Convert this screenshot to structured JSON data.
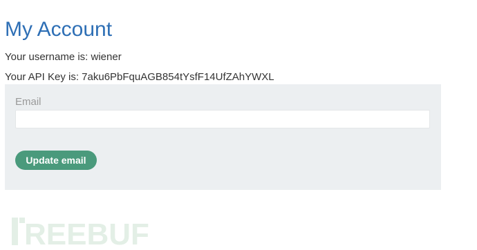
{
  "page": {
    "title": "My Account"
  },
  "account": {
    "username_line": "Your username is: wiener",
    "api_key_line": "Your API Key is: 7aku6PbFquAGB854tYsfF14UfZAhYWXL"
  },
  "email_form": {
    "label": "Email",
    "value": "",
    "placeholder": "",
    "submit_label": "Update email"
  },
  "watermark": {
    "text": "FREEBUF"
  },
  "colors": {
    "title": "#2e6fb5",
    "form_background": "#eceff1",
    "button": "#4a9a7c",
    "watermark": "#e3efe6"
  }
}
